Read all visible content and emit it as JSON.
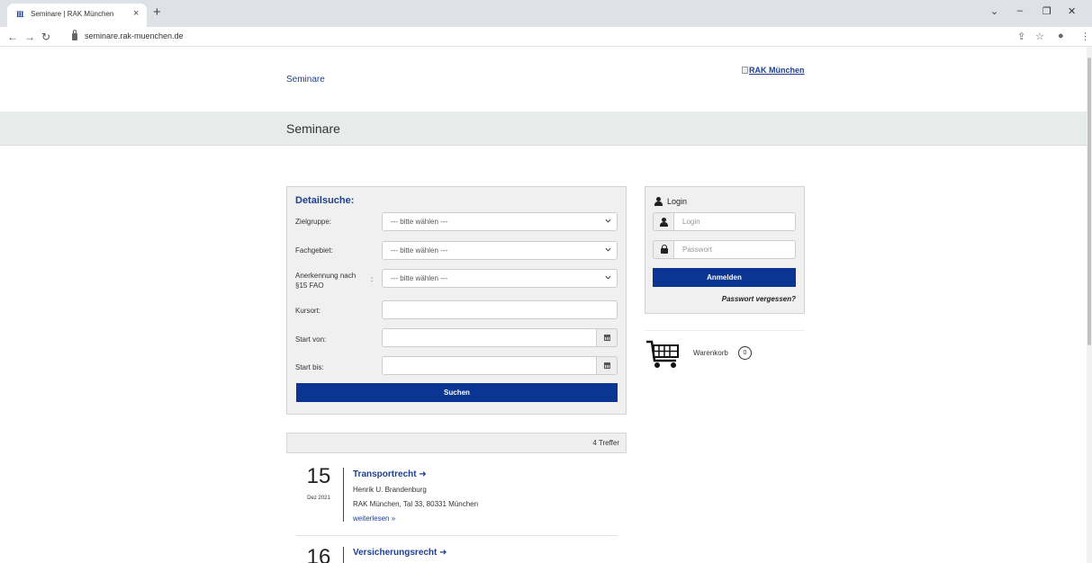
{
  "browser": {
    "tab_favicon": "III",
    "tab_title": "Seminare | RAK München",
    "tab_close": "×",
    "new_tab": "+",
    "url": "seminare.rak-muenchen.de"
  },
  "header": {
    "nav_link": "Seminare",
    "logo_alt": "RAK München",
    "band_title": "Seminare"
  },
  "search": {
    "title": "Detailsuche:",
    "fields": {
      "zielgruppe": {
        "label": "Zielgruppe:",
        "value": "--- bitte wählen ---"
      },
      "fachgebiet": {
        "label": "Fachgebiet:",
        "value": "--- bitte wählen ---"
      },
      "anerkennung": {
        "label_1": "Anerkennung nach",
        "label_2": "§15 FAO",
        "colon": ":",
        "value": "--- bitte wählen ---"
      },
      "kursort": {
        "label": "Kursort:",
        "value": ""
      },
      "start_von": {
        "label": "Start von:",
        "value": ""
      },
      "start_bis": {
        "label": "Start bis:",
        "value": ""
      }
    },
    "submit_label": "Suchen"
  },
  "results": {
    "count_label": "4 Treffer",
    "events": [
      {
        "day": "15",
        "month": "Dez 2021",
        "title": "Transportrecht ➜",
        "speaker": "Henrik U. Brandenburg",
        "location": "RAK München, Tal 33, 80331 München",
        "more": "weiterlesen »"
      },
      {
        "day": "16",
        "title": "Versicherungsrecht ➜"
      }
    ]
  },
  "login": {
    "title": "Login",
    "username_placeholder": "Login",
    "password_placeholder": "Passwort",
    "submit_label": "Anmelden",
    "forgot_label": "Passwort vergessen?"
  },
  "cart": {
    "label": "Warenkorb",
    "count": "0"
  },
  "colors": {
    "brand_blue": "#0a3592",
    "link_blue": "#1e3f8f",
    "band_bg": "#e7ebea"
  }
}
